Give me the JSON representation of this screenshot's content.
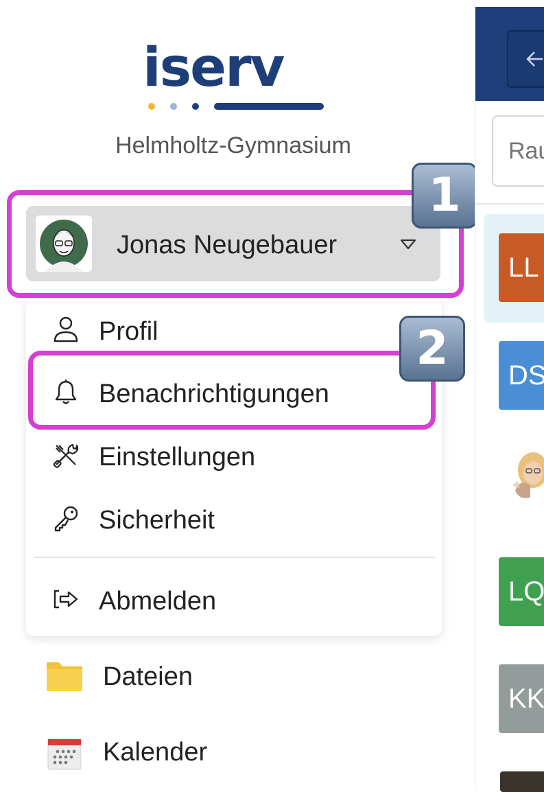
{
  "brand": {
    "logo_text": "iserv",
    "logo_color": "#1d3e78",
    "logo_dots": [
      "#f2b52c",
      "#9fb4d6",
      "#1d3e78"
    ]
  },
  "school_name": "Helmholtz-Gymnasium",
  "user": {
    "name": "Jonas Neugebauer",
    "avatar_icon": "user-avatar-photo",
    "caret_icon": "caret-down-icon"
  },
  "highlights": {
    "accent": "#d63fd3",
    "badge1": "1",
    "badge2": "2"
  },
  "user_menu": {
    "items": [
      {
        "label": "Profil",
        "icon": "person-icon"
      },
      {
        "label": "Benachrichtigungen",
        "icon": "bell-icon"
      },
      {
        "label": "Einstellungen",
        "icon": "tools-icon"
      },
      {
        "label": "Sicherheit",
        "icon": "key-icon"
      }
    ],
    "logout": {
      "label": "Abmelden",
      "icon": "logout-icon"
    }
  },
  "nav": {
    "items": [
      {
        "label": "Dateien",
        "icon": "folder-icon"
      },
      {
        "label": "Kalender",
        "icon": "calendar-icon"
      }
    ]
  },
  "right_panel": {
    "search_placeholder": "Rau",
    "rooms": [
      {
        "label": "LL",
        "color": "#c85a25"
      },
      {
        "label": "DS",
        "color": "#4a8fd6"
      },
      {
        "label": "LQ",
        "color": "#3fa14f"
      },
      {
        "label": "KK",
        "color": "#939b9b"
      }
    ]
  }
}
